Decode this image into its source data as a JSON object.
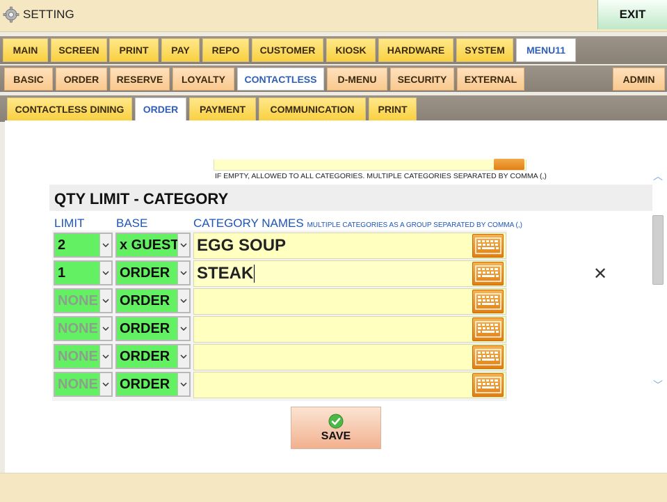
{
  "window": {
    "title": "SETTING",
    "exit_label": "EXIT"
  },
  "tabs_level1": [
    "MAIN",
    "SCREEN",
    "PRINT",
    "PAY",
    "REPO",
    "CUSTOMER",
    "KIOSK",
    "HARDWARE",
    "SYSTEM",
    "MENU11"
  ],
  "tabs_level1_active": "MENU11",
  "tabs_level2": [
    "BASIC",
    "ORDER",
    "RESERVE",
    "LOYALTY",
    "CONTACTLESS",
    "D-MENU",
    "SECURITY",
    "EXTERNAL",
    "ADMIN"
  ],
  "tabs_level2_active": "CONTACTLESS",
  "tabs_level3": [
    "CONTACTLESS DINING",
    "ORDER",
    "PAYMENT",
    "COMMUNICATION",
    "PRINT"
  ],
  "tabs_level3_active": "ORDER",
  "previous_hint": "IF EMPTY, ALLOWED TO ALL CATEGORIES. MULTIPLE CATEGORIES SEPARATED BY COMMA (,)",
  "section": {
    "title": "QTY LIMIT - CATEGORY",
    "col_limit": "LIMIT",
    "col_base": "BASE",
    "col_names": "CATEGORY NAMES",
    "col_names_hint": "MULTIPLE CATEGORIES AS A GROUP SEPARATED BY COMMA (,)"
  },
  "rows": [
    {
      "limit": "2",
      "base": "x GUEST",
      "names": "EGG SOUP"
    },
    {
      "limit": "1",
      "base": "ORDER",
      "names": "STEAK"
    },
    {
      "limit": "NONE",
      "base": "ORDER",
      "names": ""
    },
    {
      "limit": "NONE",
      "base": "ORDER",
      "names": ""
    },
    {
      "limit": "NONE",
      "base": "ORDER",
      "names": ""
    },
    {
      "limit": "NONE",
      "base": "ORDER",
      "names": ""
    }
  ],
  "save_label": "SAVE",
  "colors": {
    "tab_yellow": "#f9d040",
    "tab_peach": "#f9c98e",
    "active_tab_text": "#2f5fb8",
    "select_green": "#63f063",
    "field_yellow": "#ffffc0",
    "keyboard_orange": "#e37f12",
    "header_blue": "#1d56b8"
  },
  "icons": [
    "gear-icon",
    "keyboard-icon",
    "clear-icon",
    "checkmark-icon",
    "chevron-down-icon",
    "scroll-up-icon",
    "scroll-down-icon"
  ]
}
